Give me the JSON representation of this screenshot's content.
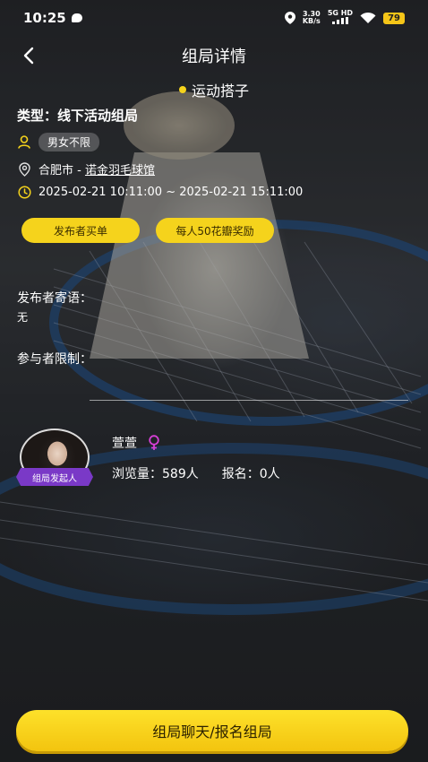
{
  "status_bar": {
    "time": "10:25",
    "network_speed_value": "3.30",
    "network_speed_unit": "KB/s",
    "signal_label": "5G HD",
    "battery": "79"
  },
  "header": {
    "title": "组局详情"
  },
  "activity_tag": "运动搭子",
  "type_line": "类型：线下活动组局",
  "gender_pill": "男女不限",
  "location": {
    "city": "合肥市 - ",
    "venue": "诺金羽毛球馆"
  },
  "time_range": "2025-02-21 10:11:00 ~ 2025-02-21 15:11:00",
  "pills": {
    "payer": "发布者买单",
    "reward": "每人50花瓣奖励"
  },
  "message": {
    "label": "发布者寄语：",
    "value": "无"
  },
  "restriction": {
    "label": "参与者限制："
  },
  "organizer": {
    "badge": "组局发起人",
    "name": "萱萱",
    "views": "浏览量：589人",
    "signups": "报名：0人"
  },
  "cta_label": "组局聊天/报名组局",
  "colors": {
    "accent_yellow": "#f5d31c",
    "badge_purple": "#7a39c7",
    "gender_icon_pink": "#d63fd6"
  }
}
